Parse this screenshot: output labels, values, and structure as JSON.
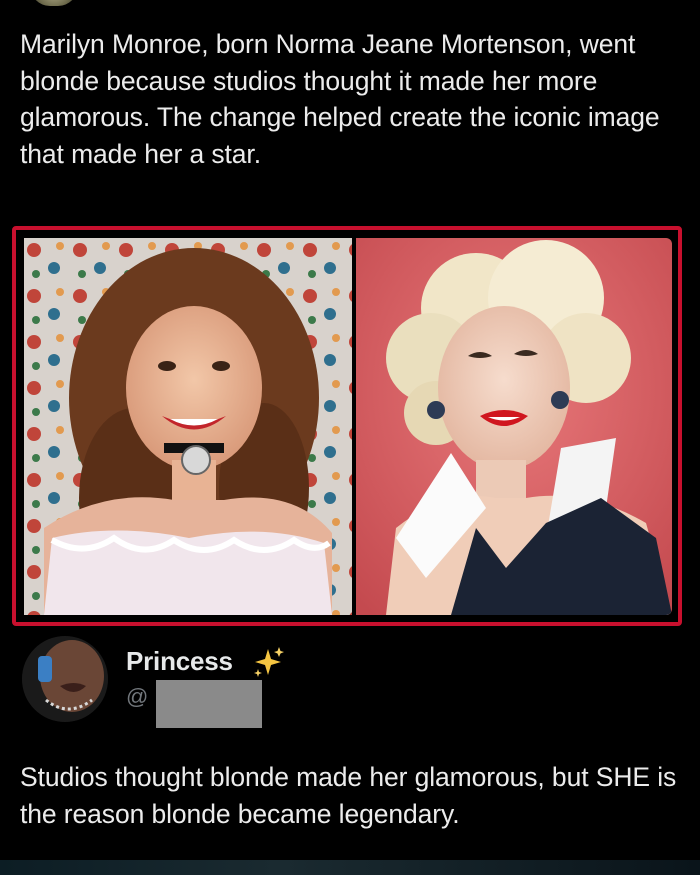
{
  "post": {
    "text": "Marilyn Monroe, born Norma Jeane Mortenson, went blonde because studios thought it made her more glamorous. The change helped create the iconic image that made her a star."
  },
  "reply": {
    "display_name": "Princess",
    "name_emoji": "sparkles-icon",
    "handle_prefix": "@",
    "text": "Studios thought blonde made her glamorous, but SHE is the reason blonde became legendary."
  },
  "colors": {
    "background": "#000000",
    "frame_accent": "#c8102e",
    "body_text": "#ececec",
    "muted_text": "#71767b",
    "redaction": "#8a8a8a",
    "sparkle": "#f5c542"
  }
}
